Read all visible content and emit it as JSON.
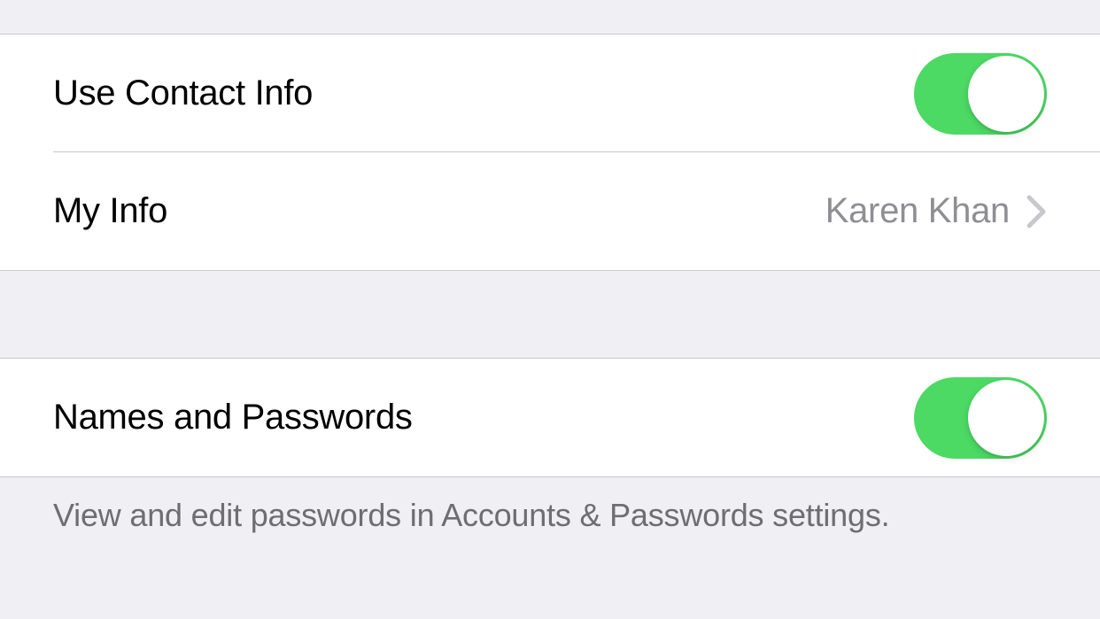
{
  "section1": {
    "useContactInfo": {
      "label": "Use Contact Info",
      "enabled": true
    },
    "myInfo": {
      "label": "My Info",
      "value": "Karen Khan"
    }
  },
  "section2": {
    "namesAndPasswords": {
      "label": "Names and Passwords",
      "enabled": true
    },
    "footer": "View and edit passwords in Accounts & Passwords settings."
  }
}
